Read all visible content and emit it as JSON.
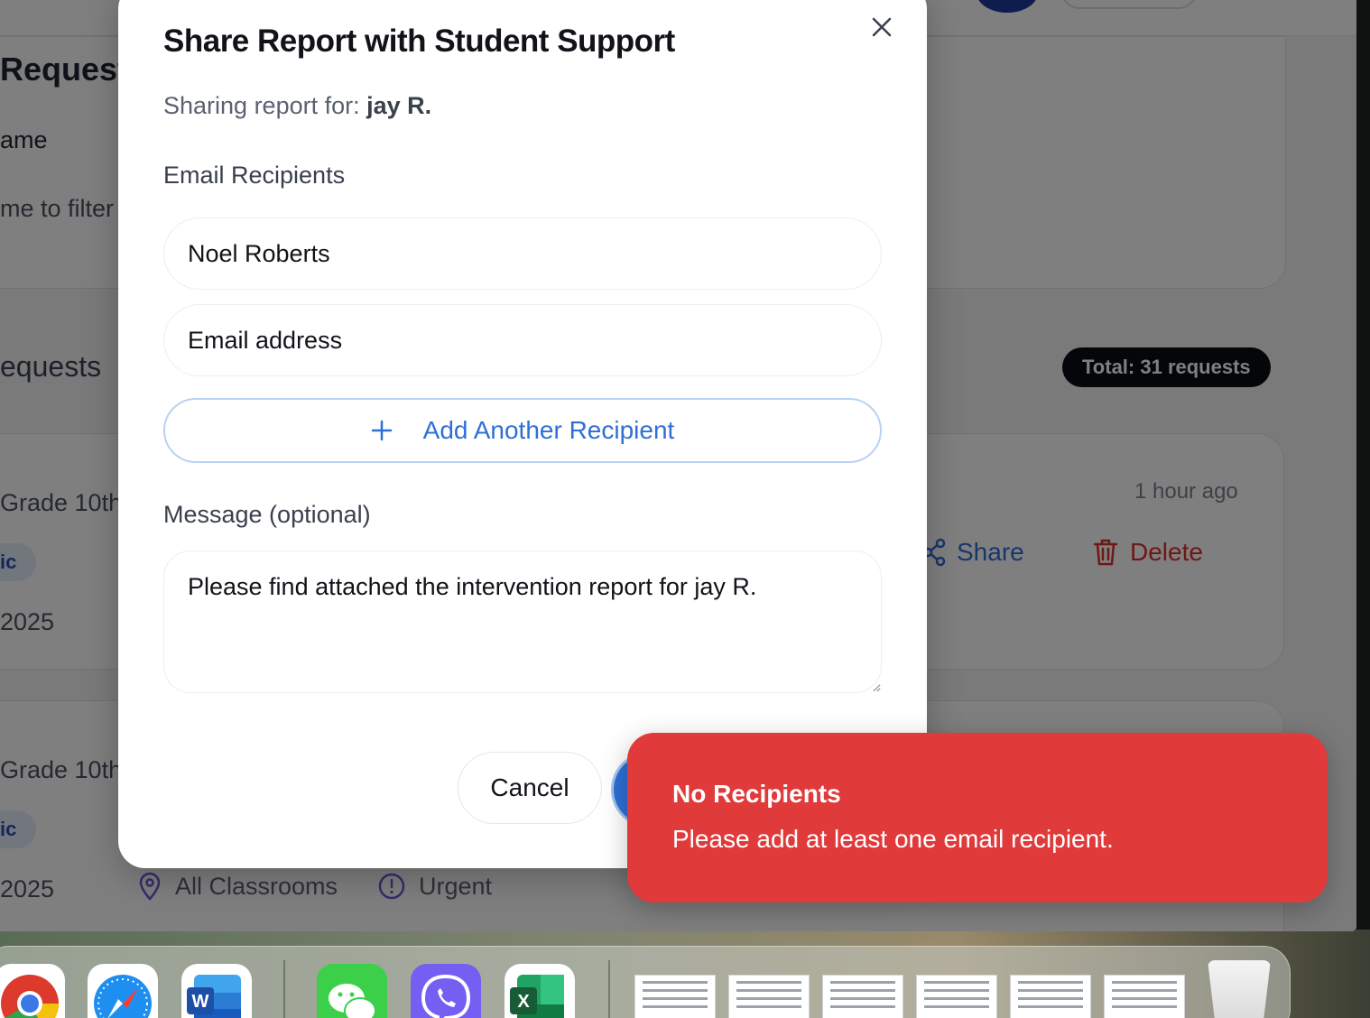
{
  "modal": {
    "title": "Share Report with Student Support",
    "subtitle_prefix": "Sharing report for: ",
    "student_name": "jay R.",
    "email_label": "Email Recipients",
    "recipient_name_value": "Noel Roberts",
    "recipient_email_placeholder": "Email address",
    "add_recipient_label": "Add Another Recipient",
    "message_label": "Message (optional)",
    "message_value": "Please find attached the intervention report for jay R.",
    "cancel_label": "Cancel"
  },
  "toast": {
    "title": "No Recipients",
    "body": "Please add at least one email recipient.",
    "color": "#e03a3a"
  },
  "background": {
    "page_title": "Request",
    "filter_label": "ame",
    "filter_hint": "me to filter",
    "section_title": "equests",
    "total_badge": "Total: 31 requests",
    "requests": [
      {
        "grade": "Grade 10th",
        "tag": "ic",
        "date": "2025",
        "time_ago": "1 hour ago",
        "share_label": "Share",
        "delete_label": "Delete"
      },
      {
        "grade": "Grade 10th",
        "tag": "ic",
        "date": "2025",
        "location": "All Classrooms",
        "priority": "Urgent"
      }
    ]
  },
  "colors": {
    "accent": "#2f6fd6",
    "danger": "#dc2f2f",
    "overlay": "rgba(0,0,0,0.5)"
  },
  "dock": {
    "apps": [
      "chrome-icon",
      "safari-icon",
      "word-icon",
      "wechat-icon",
      "viber-icon",
      "excel-icon"
    ],
    "recent_documents": 6
  }
}
